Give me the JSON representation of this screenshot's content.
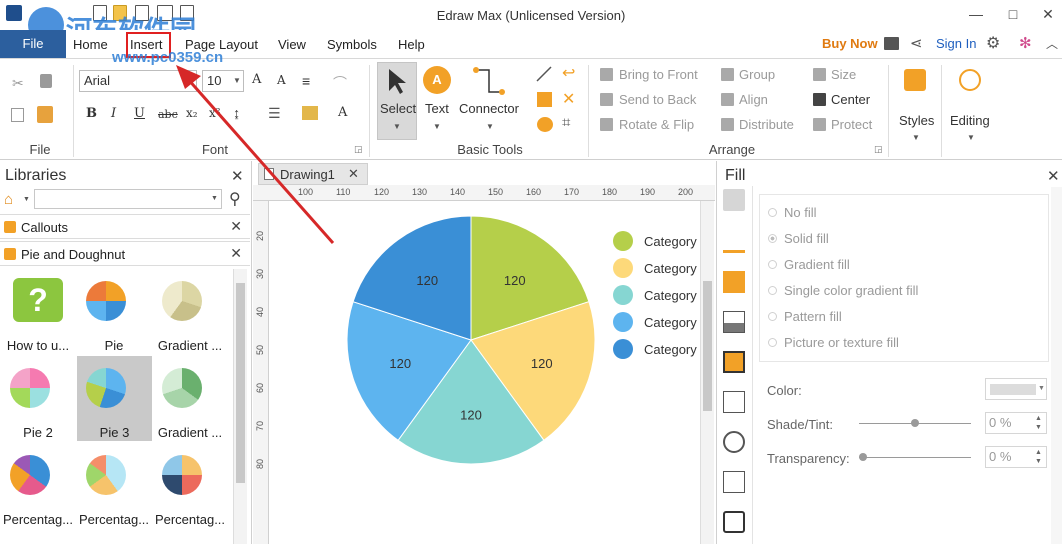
{
  "window": {
    "title": "Edraw Max (Unlicensed Version)",
    "watermark_text": "河东软件园",
    "watermark_url": "www.pc0359.cn"
  },
  "tabs": [
    "File",
    "Home",
    "Insert",
    "Page Layout",
    "View",
    "Symbols",
    "Help"
  ],
  "account": {
    "buy_now": "Buy Now",
    "sign_in": "Sign In"
  },
  "ribbon": {
    "font_name": "Arial",
    "font_size": "10",
    "group_file": "File",
    "group_font": "Font",
    "group_basic_tools": "Basic Tools",
    "group_arrange": "Arrange",
    "select": "Select",
    "text": "Text",
    "connector": "Connector",
    "bring_to_front": "Bring to Front",
    "send_to_back": "Send to Back",
    "rotate_flip": "Rotate & Flip",
    "group": "Group",
    "align": "Align",
    "distribute": "Distribute",
    "size": "Size",
    "center": "Center",
    "protect": "Protect",
    "styles": "Styles",
    "editing": "Editing"
  },
  "libraries": {
    "title": "Libraries",
    "sections": [
      "Callouts",
      "Pie and Doughnut"
    ],
    "items": [
      "How to u...",
      "Pie",
      "Gradient ...",
      "Pie 2",
      "Pie 3",
      "Gradient ...",
      "Percentag...",
      "Percentag...",
      "Percentag..."
    ]
  },
  "document": {
    "tab": "Drawing1",
    "ruler_h": [
      "100",
      "110",
      "120",
      "130",
      "140",
      "150",
      "160",
      "170",
      "180",
      "190",
      "200"
    ],
    "ruler_v": [
      "20",
      "30",
      "40",
      "50",
      "60",
      "70",
      "80"
    ]
  },
  "chart_data": {
    "type": "pie",
    "categories": [
      "Category",
      "Category",
      "Category",
      "Category",
      "Category"
    ],
    "values": [
      120,
      120,
      120,
      120,
      120
    ],
    "colors": [
      "#b5cf4a",
      "#fdd97a",
      "#86d6d2",
      "#5db4ef",
      "#3a8fd6"
    ],
    "legend_position": "right"
  },
  "fill_panel": {
    "title": "Fill",
    "options": [
      "No fill",
      "Solid fill",
      "Gradient fill",
      "Single color gradient fill",
      "Pattern fill",
      "Picture or texture fill"
    ],
    "color_label": "Color:",
    "shade_label": "Shade/Tint:",
    "shade_value": "0 %",
    "transparency_label": "Transparency:",
    "transparency_value": "0 %"
  }
}
